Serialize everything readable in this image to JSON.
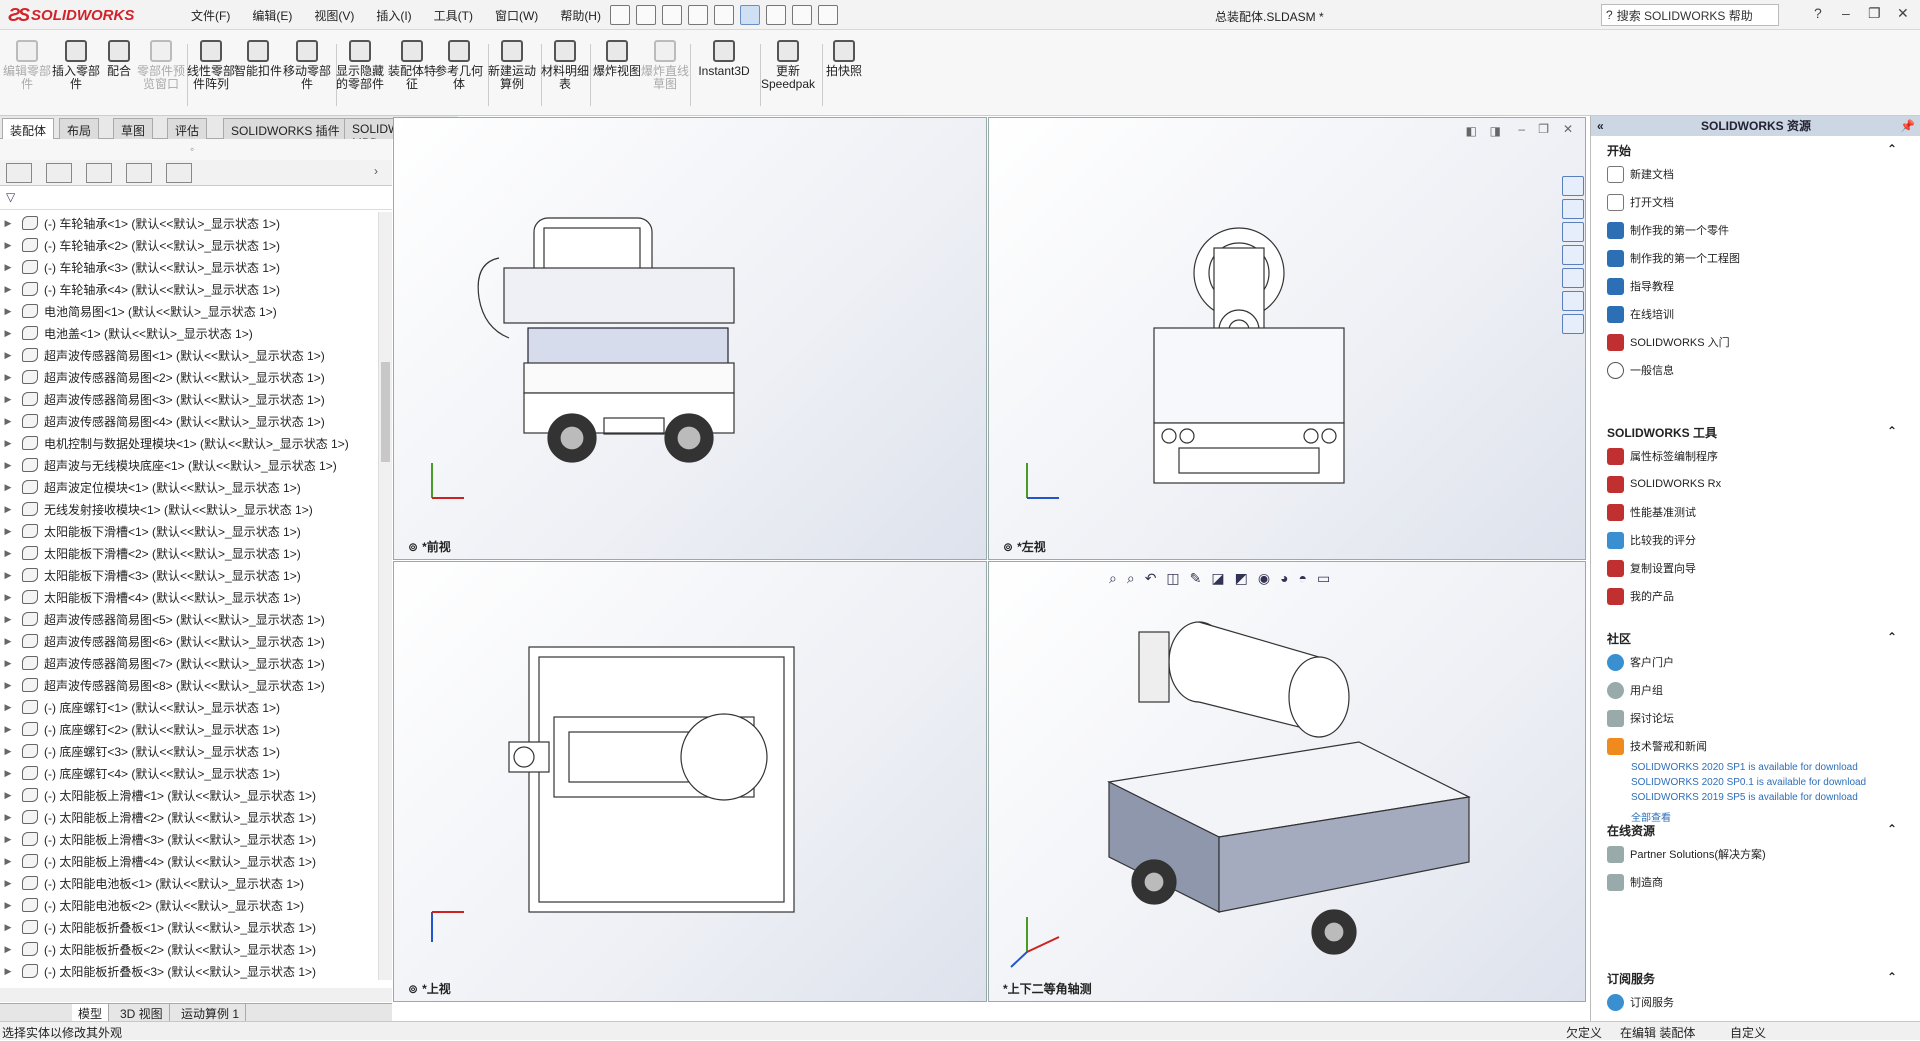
{
  "app": {
    "logo": "SOLIDWORKS",
    "doc_title": "总装配体.SLDASM *"
  },
  "menu": [
    "文件(F)",
    "编辑(E)",
    "视图(V)",
    "插入(I)",
    "工具(T)",
    "窗口(W)",
    "帮助(H)"
  ],
  "search": {
    "placeholder": "搜索 SOLIDWORKS 帮助"
  },
  "window": {
    "help": "?",
    "minimize": "–",
    "restore": "❐",
    "close": "✕"
  },
  "commands": [
    {
      "label": "编辑零部件",
      "disabled": true
    },
    {
      "label": "插入零部件",
      "disabled": false
    },
    {
      "label": "配合",
      "disabled": false
    },
    {
      "label": "零部件预览窗口",
      "disabled": true
    },
    {
      "label": "线性零部件阵列",
      "disabled": false
    },
    {
      "label": "智能扣件",
      "disabled": false
    },
    {
      "label": "移动零部件",
      "disabled": false
    },
    {
      "label": "显示隐藏的零部件",
      "disabled": false
    },
    {
      "label": "装配体特征",
      "disabled": false
    },
    {
      "label": "参考几何体",
      "disabled": false
    },
    {
      "label": "新建运动算例",
      "disabled": false
    },
    {
      "label": "材料明细表",
      "disabled": false
    },
    {
      "label": "爆炸视图",
      "disabled": false
    },
    {
      "label": "爆炸直线草图",
      "disabled": true
    },
    {
      "label": "Instant3D",
      "disabled": false
    },
    {
      "label": "更新Speedpak",
      "disabled": false
    },
    {
      "label": "拍快照",
      "disabled": false
    }
  ],
  "tabs": [
    "装配体",
    "布局",
    "草图",
    "评估",
    "SOLIDWORKS 插件",
    "SOLIDWORKS MBD"
  ],
  "tree": [
    "(-) 车轮轴承<1> (默认<<默认>_显示状态 1>)",
    "(-) 车轮轴承<2> (默认<<默认>_显示状态 1>)",
    "(-) 车轮轴承<3> (默认<<默认>_显示状态 1>)",
    "(-) 车轮轴承<4> (默认<<默认>_显示状态 1>)",
    "电池简易图<1> (默认<<默认>_显示状态 1>)",
    "电池盖<1> (默认<<默认>_显示状态 1>)",
    "超声波传感器简易图<1> (默认<<默认>_显示状态 1>)",
    "超声波传感器简易图<2> (默认<<默认>_显示状态 1>)",
    "超声波传感器简易图<3> (默认<<默认>_显示状态 1>)",
    "超声波传感器简易图<4> (默认<<默认>_显示状态 1>)",
    "电机控制与数据处理模块<1> (默认<<默认>_显示状态 1>)",
    "超声波与无线模块底座<1> (默认<<默认>_显示状态 1>)",
    "超声波定位模块<1> (默认<<默认>_显示状态 1>)",
    "无线发射接收模块<1> (默认<<默认>_显示状态 1>)",
    "太阳能板下滑槽<1> (默认<<默认>_显示状态 1>)",
    "太阳能板下滑槽<2> (默认<<默认>_显示状态 1>)",
    "太阳能板下滑槽<3> (默认<<默认>_显示状态 1>)",
    "太阳能板下滑槽<4> (默认<<默认>_显示状态 1>)",
    "超声波传感器简易图<5> (默认<<默认>_显示状态 1>)",
    "超声波传感器简易图<6> (默认<<默认>_显示状态 1>)",
    "超声波传感器简易图<7> (默认<<默认>_显示状态 1>)",
    "超声波传感器简易图<8> (默认<<默认>_显示状态 1>)",
    "(-) 底座螺钉<1> (默认<<默认>_显示状态 1>)",
    "(-) 底座螺钉<2> (默认<<默认>_显示状态 1>)",
    "(-) 底座螺钉<3> (默认<<默认>_显示状态 1>)",
    "(-) 底座螺钉<4> (默认<<默认>_显示状态 1>)",
    "(-) 太阳能板上滑槽<1> (默认<<默认>_显示状态 1>)",
    "(-) 太阳能板上滑槽<2> (默认<<默认>_显示状态 1>)",
    "(-) 太阳能板上滑槽<3> (默认<<默认>_显示状态 1>)",
    "(-) 太阳能板上滑槽<4> (默认<<默认>_显示状态 1>)",
    "(-) 太阳能电池板<1> (默认<<默认>_显示状态 1>)",
    "(-) 太阳能电池板<2> (默认<<默认>_显示状态 1>)",
    "(-) 太阳能板折叠板<1> (默认<<默认>_显示状态 1>)",
    "(-) 太阳能板折叠板<2> (默认<<默认>_显示状态 1>)",
    "(-) 太阳能板折叠板<3> (默认<<默认>_显示状态 1>)"
  ],
  "bottom_tabs": [
    "模型",
    "3D 视图",
    "运动算例 1"
  ],
  "viewports": {
    "front": "*前视",
    "left": "*左视",
    "top": "*上视",
    "iso": "*上下二等角轴测"
  },
  "status": {
    "left": "选择实体以修改其外观",
    "custom1": "欠定义",
    "editing": "在编辑 装配体",
    "custom2": "自定义"
  },
  "resources": {
    "title": "SOLIDWORKS 资源",
    "start": {
      "heading": "开始",
      "items": [
        "新建文档",
        "打开文档",
        "制作我的第一个零件",
        "制作我的第一个工程图",
        "指导教程",
        "在线培训",
        "SOLIDWORKS 入门",
        "一般信息"
      ]
    },
    "tools": {
      "heading": "SOLIDWORKS 工具",
      "items": [
        "属性标签编制程序",
        "SOLIDWORKS Rx",
        "性能基准测试",
        "比较我的评分",
        "复制设置向导",
        "我的产品"
      ]
    },
    "community": {
      "heading": "社区",
      "items": [
        "客户门户",
        "用户组",
        "探讨论坛",
        "技术警戒和新闻"
      ],
      "links": [
        "SOLIDWORKS 2020 SP1 is available for download",
        "SOLIDWORKS 2020 SP0.1 is available for download",
        "SOLIDWORKS 2019 SP5 is available for download"
      ],
      "more": "全部查看"
    },
    "online": {
      "heading": "在线资源",
      "items": [
        "Partner Solutions(解决方案)",
        "制造商"
      ]
    },
    "subscription": {
      "heading": "订阅服务",
      "items": [
        "订阅服务"
      ]
    }
  }
}
